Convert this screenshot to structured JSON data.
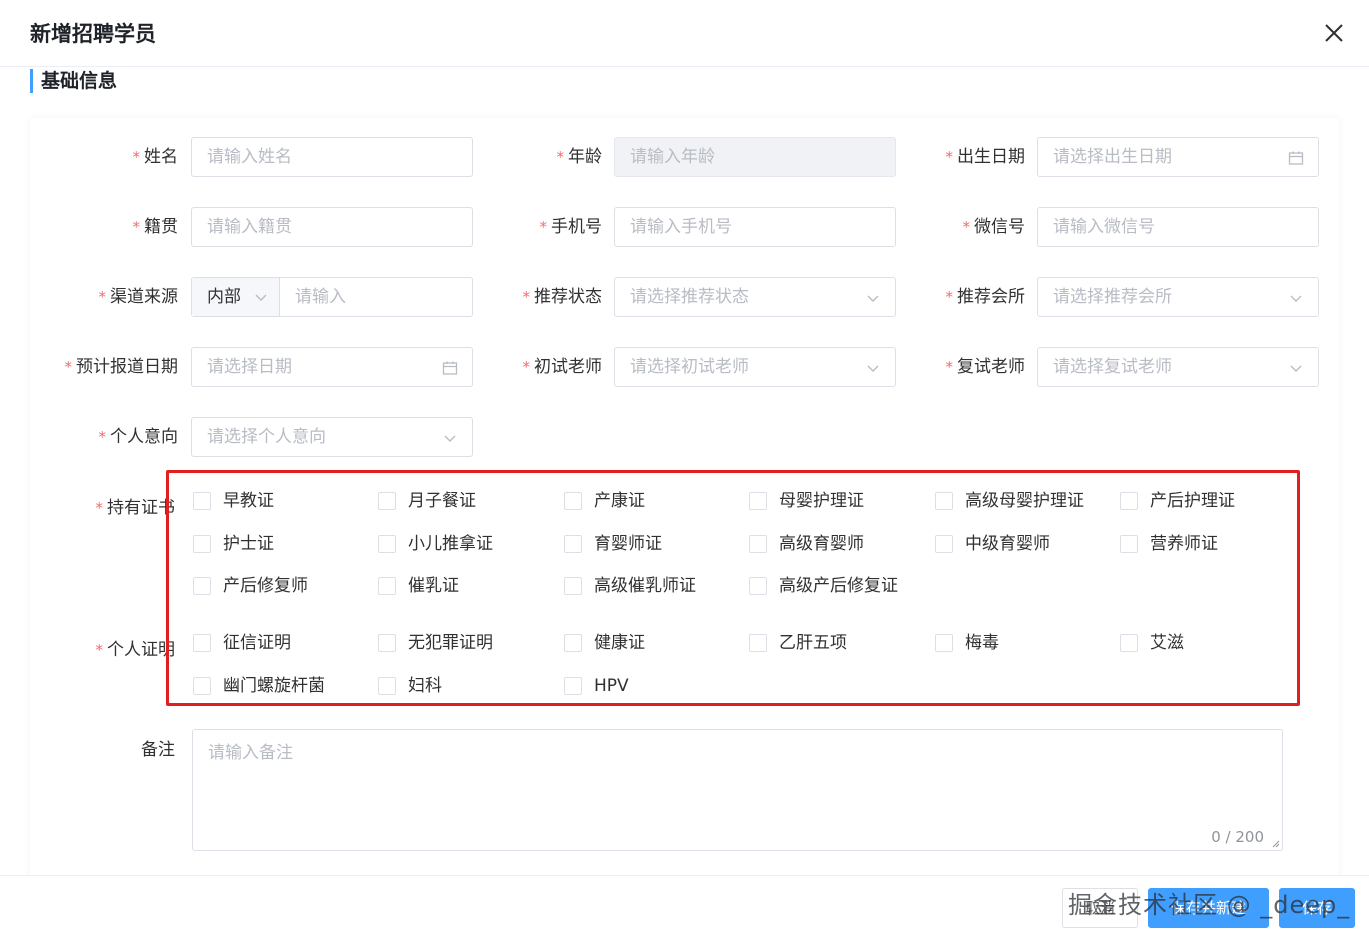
{
  "dialog": {
    "title": "新增招聘学员"
  },
  "section": {
    "title": "基础信息"
  },
  "fields": {
    "name": {
      "label": "姓名",
      "placeholder": "请输入姓名"
    },
    "age": {
      "label": "年龄",
      "placeholder": "请输入年龄"
    },
    "birth": {
      "label": "出生日期",
      "placeholder": "请选择出生日期"
    },
    "native": {
      "label": "籍贯",
      "placeholder": "请输入籍贯"
    },
    "phone": {
      "label": "手机号",
      "placeholder": "请输入手机号"
    },
    "wechat": {
      "label": "微信号",
      "placeholder": "请输入微信号"
    },
    "channel": {
      "label": "渠道来源",
      "select_value": "内部",
      "placeholder": "请输入"
    },
    "rec_status": {
      "label": "推荐状态",
      "placeholder": "请选择推荐状态"
    },
    "rec_club": {
      "label": "推荐会所",
      "placeholder": "请选择推荐会所"
    },
    "report_date": {
      "label": "预计报道日期",
      "placeholder": "请选择日期"
    },
    "first_teacher": {
      "label": "初试老师",
      "placeholder": "请选择初试老师"
    },
    "second_teacher": {
      "label": "复试老师",
      "placeholder": "请选择复试老师"
    },
    "intent": {
      "label": "个人意向",
      "placeholder": "请选择个人意向"
    },
    "remark": {
      "label": "备注",
      "placeholder": "请输入备注",
      "count": "0 / 200"
    }
  },
  "certificates": {
    "label": "持有证书",
    "items": [
      "早教证",
      "月子餐证",
      "产康证",
      "母婴护理证",
      "高级母婴护理证",
      "产后护理证",
      "护士证",
      "小儿推拿证",
      "育婴师证",
      "高级育婴师",
      "中级育婴师",
      "营养师证",
      "产后修复师",
      "催乳证",
      "高级催乳师证",
      "高级产后修复证"
    ]
  },
  "proofs": {
    "label": "个人证明",
    "items": [
      "征信证明",
      "无犯罪证明",
      "健康证",
      "乙肝五项",
      "梅毒",
      "艾滋",
      "幽门螺旋杆菌",
      "妇科",
      "HPV"
    ]
  },
  "footer": {
    "cancel_label": "取消",
    "save_continue_label": "保存并新建",
    "save_label": "保存",
    "watermark": "掘金技术社区 @ _deep_"
  },
  "colors": {
    "primary": "#409eff",
    "required": "#f56c6c",
    "highlight": "#e02020"
  },
  "icons": {
    "close": "close-icon",
    "calendar": "calendar-icon",
    "dropdown": "chevron-down-icon"
  }
}
